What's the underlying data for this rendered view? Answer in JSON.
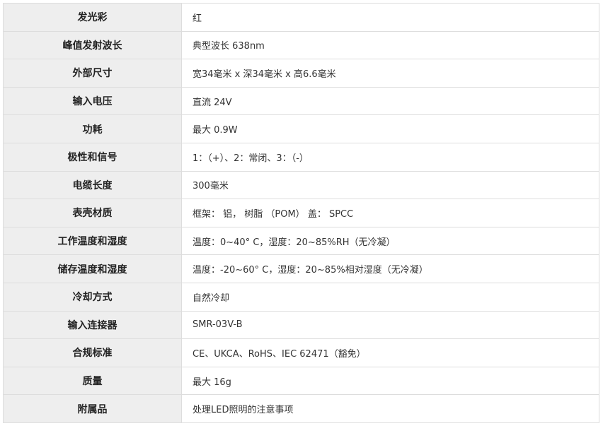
{
  "spec_table": {
    "rows": [
      {
        "label": "发光彩",
        "value": "红"
      },
      {
        "label": "峰值发射波长",
        "value": "典型波长 638nm"
      },
      {
        "label": "外部尺寸",
        "value": "宽34毫米 x 深34毫米 x 高6.6毫米"
      },
      {
        "label": "输入电压",
        "value": "直流 24V"
      },
      {
        "label": "功耗",
        "value": "最大 0.9W"
      },
      {
        "label": "极性和信号",
        "value": "1：（+）、2：常闭、3：（-）"
      },
      {
        "label": "电缆长度",
        "value": "300毫米"
      },
      {
        "label": "表壳材质",
        "value": "框架： 铝， 树脂 （POM） 盖： SPCC"
      },
      {
        "label": "工作温度和湿度",
        "value": "温度：0~40° C，湿度：20~85%RH（无冷凝）"
      },
      {
        "label": "储存温度和湿度",
        "value": "温度：-20~60° C，湿度：20~85%相对湿度（无冷凝）"
      },
      {
        "label": "冷却方式",
        "value": "自然冷却"
      },
      {
        "label": "输入连接器",
        "value": "SMR-03V-B"
      },
      {
        "label": "合规标准",
        "value": "CE、UKCA、RoHS、IEC 62471（豁免）"
      },
      {
        "label": "质量",
        "value": "最大 16g"
      },
      {
        "label": "附属品",
        "value": "处理LED照明的注意事项"
      }
    ]
  }
}
